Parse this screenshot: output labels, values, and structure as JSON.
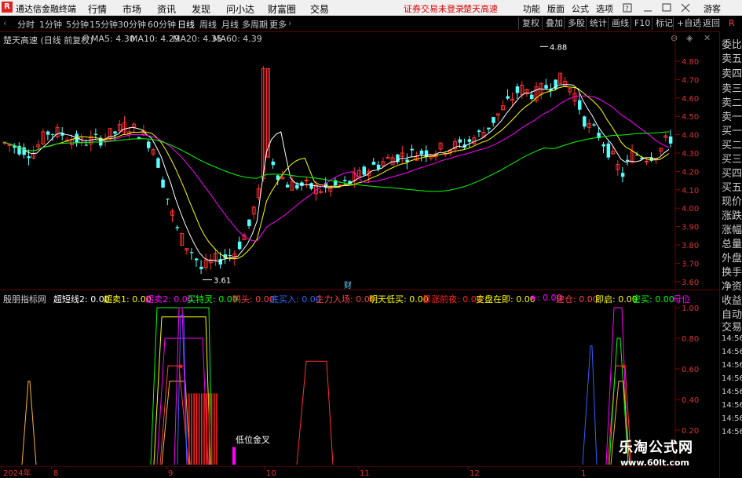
{
  "titlebar": {
    "logo": "R",
    "app_name": "通达信金融终端",
    "menus": [
      "行情",
      "市场",
      "资讯",
      "发现",
      "问小达",
      "财富圈",
      "交易"
    ],
    "status_text": "证券交易未登录",
    "stock_name": "楚天高速",
    "right_menus": [
      "功能",
      "版面",
      "公式",
      "选项"
    ],
    "icons": [
      "help-icon",
      "minimize-icon",
      "window-icon",
      "close-icon"
    ],
    "user": "游客"
  },
  "toolbar": {
    "periods": [
      "分时",
      "1分钟",
      "5分钟",
      "15分钟",
      "30分钟",
      "60分钟",
      "日线",
      "周线",
      "月线",
      "多周期",
      "更多"
    ],
    "active_period": "日线",
    "right_tools": [
      "复权",
      "叠加",
      "多股",
      "统计",
      "画线",
      "F10",
      "标记",
      "+自选",
      "返回"
    ],
    "side_tab": "R"
  },
  "main_chart": {
    "title": "楚天高速 (日线 前复权)",
    "ma_labels": [
      {
        "text": "MA5: 4.30",
        "color": "#ffffff"
      },
      {
        "text": "MA10: 4.29",
        "color": "#ffff00"
      },
      {
        "text": "MA20: 4.35",
        "color": "#ff00ff"
      },
      {
        "text": "MA60: 4.39",
        "color": "#00ff00"
      }
    ],
    "y_ticks": [
      "4.80",
      "4.70",
      "4.60",
      "4.50",
      "4.40",
      "4.30",
      "4.20",
      "4.10",
      "4.00",
      "3.90",
      "3.80",
      "3.70",
      "3.60"
    ],
    "high_label": "4.88",
    "low_label": "3.61",
    "marker": "财"
  },
  "indicator": {
    "name": "殷朋指标网",
    "items": [
      {
        "text": "超短线2: 0.00",
        "color": "#ffffff"
      },
      {
        "text": "超卖1: 0.00",
        "color": "#ffff00"
      },
      {
        "text": "超卖2: 0.00",
        "color": "#ff00ff"
      },
      {
        "text": "买特灵: 0.00",
        "color": "#00ff00"
      },
      {
        "text": "鸭头: 0.00",
        "color": "#ff4040"
      },
      {
        "text": "底买入: 0.00",
        "color": "#3060ff"
      },
      {
        "text": "主力入场: 0.00",
        "color": "#ff4040"
      },
      {
        "text": "明天低买: 0.00",
        "color": "#ffff00"
      },
      {
        "text": "暴涨前夜: 0.00",
        "color": "#ff2020"
      },
      {
        "text": "变盘在即: 0.00",
        "color": "#ffff00"
      },
      {
        "text": "★: 0.00",
        "color": "#ff00ff"
      },
      {
        "text": "建仓: 0.00",
        "color": "#ff4040"
      },
      {
        "text": "即启: 0.00",
        "color": "#ffff00"
      },
      {
        "text": "密买: 0.00",
        "color": "#00ff00"
      },
      {
        "text": "母位",
        "color": "#ff00ff"
      }
    ],
    "y_ticks": [
      "1.00",
      "0.80",
      "0.60",
      "0.40",
      "0.20"
    ],
    "annotation": "低位金叉"
  },
  "x_axis": {
    "labels": [
      "2024年",
      "8",
      "9",
      "10",
      "11",
      "12",
      "1"
    ]
  },
  "sidebar": {
    "items": [
      "委比",
      "卖五",
      "卖四",
      "卖三",
      "卖二",
      "卖一",
      "买一",
      "买二",
      "买三",
      "买四",
      "买五",
      "现价",
      "涨跌",
      "涨幅",
      "总量",
      "外盘",
      "换手",
      "净资",
      "收益",
      "自动",
      "交易"
    ],
    "times": [
      "14:56",
      "14:56",
      "14:56",
      "14:56",
      "14:56",
      "14:56",
      "14:56",
      "14:56"
    ]
  },
  "watermark": {
    "name": "乐淘公式网",
    "url": "www.60lt.com"
  },
  "colors": {
    "up": "#ff3232",
    "down": "#54ffff",
    "border": "#800000"
  }
}
